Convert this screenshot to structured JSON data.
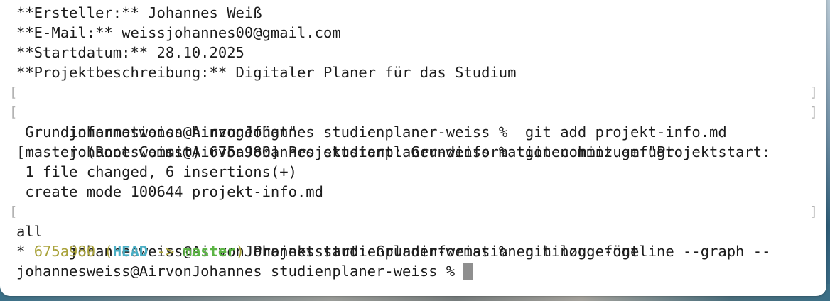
{
  "terminal": {
    "lines": [
      {
        "text": "**Ersteller:** Johannes Weiß"
      },
      {
        "text": "**E-Mail:** weissjohannes00@gmail.com"
      },
      {
        "text": "**Startdatum:** 28.10.2025"
      },
      {
        "text": "**Projektbeschreibung:** Digitaler Planer für das Studium"
      },
      {
        "text": "johannesweiss@AirvonJohannes studienplaner-weiss %  git add projekt-info.md"
      },
      {
        "text": "johannesweiss@AirvonJohannes studienplaner-weiss %  git commit -m \"Projektstart:"
      },
      {
        "text": " Grundinformationen hinzugefügt\""
      },
      {
        "text": "[master (Root-Commit) 675a980] Projektstart: Grundinformationen hinzugefügt"
      },
      {
        "text": " 1 file changed, 6 insertions(+)"
      },
      {
        "text": " create mode 100644 projekt-info.md"
      },
      {
        "text": "johannesweiss@AirvonJohannes studienplaner-weiss %  git log --oneline --graph --"
      },
      {
        "text": "all"
      }
    ],
    "log_line": {
      "star": "* ",
      "hash": "675a980",
      "paren_open": " (",
      "head": "HEAD",
      "arrow": " -> ",
      "branch": "master",
      "paren_close": ")",
      "message": " Projektstart: Grundinformationen hinzugefügt"
    },
    "prompt": "johannesweiss@AirvonJohannes studienplaner-weiss % "
  },
  "colors": {
    "background": "#ffffff",
    "text": "#1c1c1c",
    "hash": "#a9a23a",
    "head": "#4aaec4",
    "branch": "#5cb545",
    "cursor": "#8f8f8f"
  }
}
